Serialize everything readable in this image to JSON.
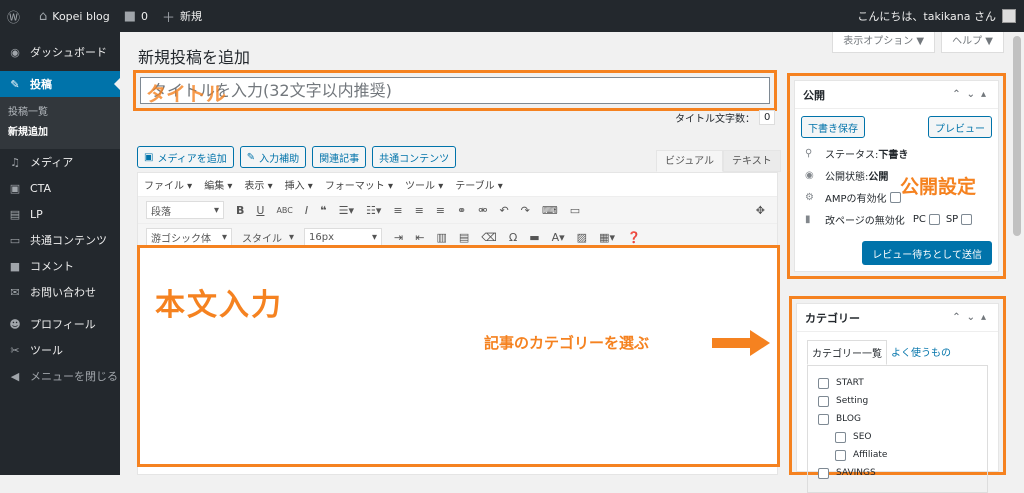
{
  "adminbar": {
    "site_name": "Kopei blog",
    "comments_count": "0",
    "new_label": "新規",
    "greeting": "こんにちは、takikana さん"
  },
  "sidebar": {
    "items": [
      {
        "label": "ダッシュボード",
        "icon": "dashboard-icon"
      },
      {
        "label": "投稿",
        "icon": "pin-icon"
      },
      {
        "label": "メディア",
        "icon": "media-icon"
      },
      {
        "label": "CTA",
        "icon": "cta-icon"
      },
      {
        "label": "LP",
        "icon": "lp-icon"
      },
      {
        "label": "共通コンテンツ",
        "icon": "folder-icon"
      },
      {
        "label": "コメント",
        "icon": "comment-icon"
      },
      {
        "label": "お問い合わせ",
        "icon": "mail-icon"
      },
      {
        "label": "プロフィール",
        "icon": "user-icon"
      },
      {
        "label": "ツール",
        "icon": "wrench-icon"
      },
      {
        "label": "メニューを閉じる",
        "icon": "collapse-icon"
      }
    ],
    "submenu": [
      "投稿一覧",
      "新規追加"
    ]
  },
  "screen_options": {
    "display": "表示オプション ▼",
    "help": "ヘルプ ▼"
  },
  "page": {
    "title": "新規投稿を追加"
  },
  "title_field": {
    "placeholder": "タイトルを入力(32文字以内推奨)",
    "overlay": "タイトル",
    "count_label": "タイトル文字数：",
    "count_value": "0"
  },
  "media_buttons": [
    "メディアを追加",
    "入力補助",
    "関連記事",
    "共通コンテンツ"
  ],
  "editor_tabs": [
    "ビジュアル",
    "テキスト"
  ],
  "menubar": [
    "ファイル ▾",
    "編集 ▾",
    "表示 ▾",
    "挿入 ▾",
    "フォーマット ▾",
    "ツール ▾",
    "テーブル ▾"
  ],
  "toolbar": {
    "paragraph": "段落",
    "font": "游ゴシック体",
    "style": "スタイル",
    "size": "16px"
  },
  "annotations": {
    "body": "本文入力",
    "category_note": "記事のカテゴリーを選ぶ",
    "publish_settings": "公開設定"
  },
  "publish": {
    "heading": "公開",
    "save_draft": "下書き保存",
    "preview": "プレビュー",
    "status": "ステータス: ",
    "status_value": "下書き",
    "visibility": "公開状態: ",
    "visibility_value": "公開",
    "amp": "AMPの有効化",
    "disable_page_break": "改ページの無効化",
    "pc": "PC",
    "sp": "SP",
    "submit": "レビュー待ちとして送信"
  },
  "categories": {
    "heading": "カテゴリー",
    "tab_all": "カテゴリー一覧",
    "tab_popular": "よく使うもの",
    "items": [
      {
        "label": "START",
        "indent": false
      },
      {
        "label": "Setting",
        "indent": false
      },
      {
        "label": "BLOG",
        "indent": false
      },
      {
        "label": "SEO",
        "indent": true
      },
      {
        "label": "Affiliate",
        "indent": true
      },
      {
        "label": "SAVINGS",
        "indent": false
      }
    ]
  },
  "colors": {
    "accent": "#f58220",
    "wp_blue": "#0073aa",
    "admin_dark": "#23282d"
  }
}
